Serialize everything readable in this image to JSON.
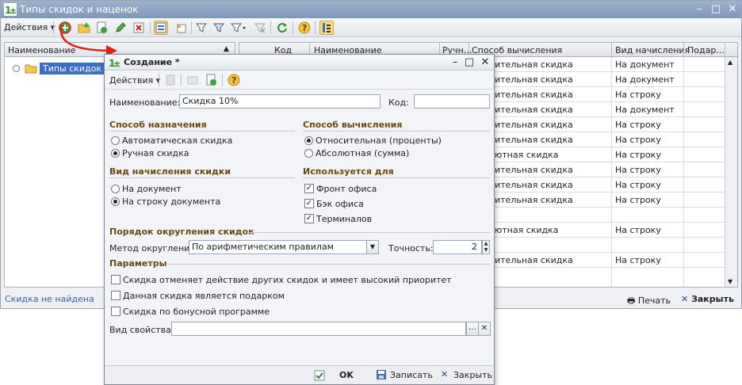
{
  "main": {
    "title": "Типы скидок и наценок",
    "actions_label": "Действия",
    "tree": {
      "header": "Наименование",
      "root_label": "Типы скидок и н"
    },
    "grid": {
      "headers": [
        "Код",
        "Наименование",
        "Ручн...",
        "Способ вычисления",
        "Вид начисления",
        "Подар..."
      ],
      "rows": [
        {
          "calc": "ительная скидка",
          "accrual": "На документ"
        },
        {
          "calc": "ительная скидка",
          "accrual": "На документ"
        },
        {
          "calc": "ительная скидка",
          "accrual": "На строку"
        },
        {
          "calc": "ительная скидка",
          "accrual": "На документ"
        },
        {
          "calc": "ительная скидка",
          "accrual": "На строку"
        },
        {
          "calc": "ительная скидка",
          "accrual": "На строку"
        },
        {
          "calc": "ютная скидка",
          "accrual": "На строку"
        },
        {
          "calc": "ительная скидка",
          "accrual": "На строку"
        },
        {
          "calc": "ительная скидка",
          "accrual": "На строку"
        },
        {
          "calc": "ительная скидка",
          "accrual": "На строку"
        },
        {
          "calc": "",
          "accrual": ""
        },
        {
          "calc": "ютная скидка",
          "accrual": "На строку"
        },
        {
          "calc": "",
          "accrual": ""
        },
        {
          "calc": "ительная скидка",
          "accrual": "На строку"
        }
      ]
    },
    "status_text": "Скидка не найдена",
    "print_label": "Печать",
    "close_label": "Закрыть"
  },
  "dialog": {
    "title": "Создание *",
    "actions_label": "Действия",
    "name_label": "Наименование:",
    "name_value": "Скидка 10%",
    "code_label": "Код:",
    "code_value": "",
    "assign": {
      "title": "Способ назначения",
      "options": [
        "Автоматическая скидка",
        "Ручная скидка"
      ],
      "selected": 1
    },
    "calc": {
      "title": "Способ вычисления",
      "options": [
        "Относительная (проценты)",
        "Абсолютная (сумма)"
      ],
      "selected": 0
    },
    "accrual": {
      "title": "Вид начисления скидки",
      "options": [
        "На документ",
        "На строку документа"
      ],
      "selected": 1
    },
    "used_for": {
      "title": "Используется для",
      "options": [
        "Фронт офиса",
        "Бэк офиса",
        "Терминалов"
      ],
      "checked": [
        true,
        true,
        true
      ]
    },
    "rounding": {
      "title": "Порядок округления скидок",
      "method_label": "Метод округления:",
      "method_value": "По арифметическим правилам",
      "precision_label": "Точность:",
      "precision_value": "2"
    },
    "params": {
      "title": "Параметры",
      "options": [
        "Скидка отменяет действие других скидок и имеет высокий приоритет",
        "Данная скидка является подарком",
        "Скидка по бонусной программе"
      ],
      "checked": [
        false,
        false,
        false
      ],
      "property_label": "Вид свойства:",
      "property_value": ""
    },
    "footer": {
      "ok_label": "OK",
      "save_label": "Записать",
      "close_label": "Закрыть"
    }
  },
  "colors": {
    "titlebar": "#8ea6c8",
    "selection": "#3a6fc4",
    "section_title": "#6b4a12",
    "callout_arrow": "#e0201b",
    "status_link": "#3a64a8"
  }
}
